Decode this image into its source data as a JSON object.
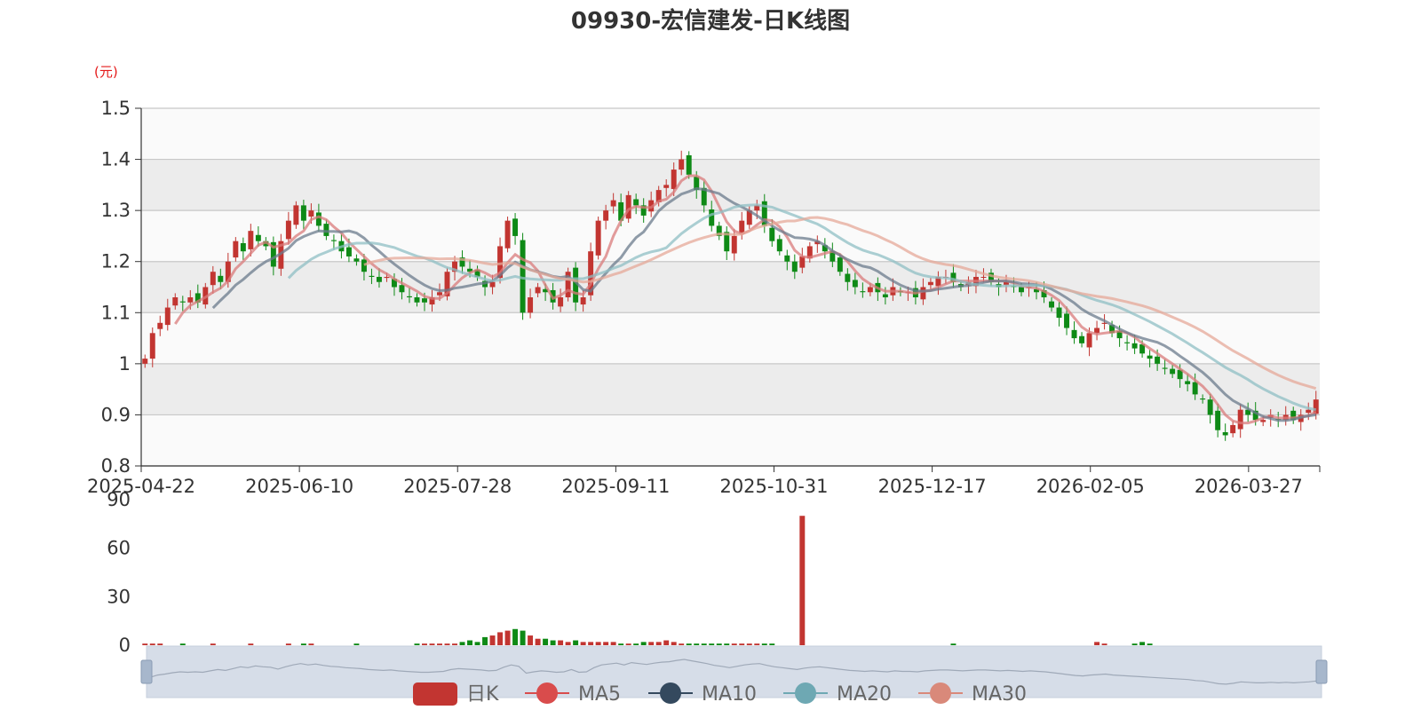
{
  "chart_data": {
    "type": "candlestick",
    "title": "09930-宏信建发-日K线图",
    "y_unit": "(元)",
    "price_axis": {
      "ylim": [
        0.8,
        1.5
      ],
      "ticks": [
        "1.5",
        "1.4",
        "1.3",
        "1.2",
        "1.1",
        "1",
        "0.9",
        "0.8"
      ]
    },
    "volume_axis": {
      "ylim": [
        0,
        90
      ],
      "ticks": [
        "90",
        "60",
        "30",
        "0"
      ]
    },
    "x_ticks": [
      "2025-04-22",
      "2025-06-10",
      "2025-07-28",
      "2025-09-11",
      "2025-10-31",
      "2025-12-17",
      "2026-02-05",
      "2026-03-27"
    ],
    "up_color": "#c23531",
    "down_color": "#0e8a16",
    "closes": [
      1.01,
      1.06,
      1.08,
      1.11,
      1.13,
      1.12,
      1.13,
      1.12,
      1.15,
      1.18,
      1.16,
      1.2,
      1.24,
      1.22,
      1.26,
      1.24,
      1.23,
      1.19,
      1.24,
      1.28,
      1.31,
      1.28,
      1.3,
      1.27,
      1.25,
      1.24,
      1.22,
      1.21,
      1.2,
      1.18,
      1.17,
      1.16,
      1.17,
      1.15,
      1.14,
      1.13,
      1.12,
      1.12,
      1.13,
      1.14,
      1.18,
      1.2,
      1.19,
      1.18,
      1.17,
      1.15,
      1.16,
      1.23,
      1.28,
      1.25,
      1.1,
      1.13,
      1.15,
      1.14,
      1.12,
      1.13,
      1.18,
      1.12,
      1.13,
      1.22,
      1.28,
      1.3,
      1.32,
      1.28,
      1.33,
      1.31,
      1.29,
      1.32,
      1.34,
      1.35,
      1.38,
      1.4,
      1.37,
      1.34,
      1.31,
      1.27,
      1.25,
      1.22,
      1.25,
      1.28,
      1.3,
      1.31,
      1.27,
      1.24,
      1.22,
      1.2,
      1.18,
      1.21,
      1.23,
      1.24,
      1.22,
      1.2,
      1.18,
      1.16,
      1.15,
      1.14,
      1.15,
      1.14,
      1.13,
      1.15,
      1.14,
      1.14,
      1.13,
      1.15,
      1.16,
      1.17,
      1.17,
      1.16,
      1.15,
      1.16,
      1.17,
      1.17,
      1.16,
      1.15,
      1.16,
      1.15,
      1.14,
      1.15,
      1.14,
      1.13,
      1.11,
      1.09,
      1.07,
      1.05,
      1.04,
      1.06,
      1.07,
      1.08,
      1.06,
      1.05,
      1.04,
      1.03,
      1.02,
      1.01,
      1.0,
      0.99,
      0.98,
      0.97,
      0.96,
      0.94,
      0.93,
      0.9,
      0.87,
      0.86,
      0.88,
      0.91,
      0.9,
      0.89,
      0.89,
      0.9,
      0.89,
      0.9,
      0.89,
      0.9,
      0.91,
      0.93
    ],
    "volumes": [
      1,
      1,
      1,
      0,
      0,
      1,
      0,
      0,
      0,
      1,
      0,
      0,
      0,
      0,
      1,
      0,
      0,
      0,
      0,
      1,
      0,
      1,
      1,
      0,
      0,
      0,
      0,
      0,
      1,
      0,
      0,
      0,
      0,
      0,
      0,
      0,
      1,
      1,
      1,
      1,
      1,
      1,
      2,
      3,
      2,
      5,
      6,
      8,
      9,
      10,
      9,
      6,
      4,
      4,
      3,
      3,
      2,
      3,
      2,
      2,
      2,
      2,
      2,
      1,
      1,
      1,
      2,
      2,
      2,
      3,
      2,
      1,
      1,
      1,
      1,
      1,
      1,
      1,
      1,
      1,
      1,
      1,
      1,
      1,
      0,
      0,
      0,
      80,
      0,
      0,
      0,
      0,
      0,
      0,
      0,
      0,
      0,
      0,
      0,
      0,
      0,
      0,
      0,
      0,
      0,
      0,
      0,
      1,
      0,
      0,
      0,
      0,
      0,
      0,
      0,
      0,
      0,
      0,
      0,
      0,
      0,
      0,
      0,
      0,
      0,
      0,
      2,
      1,
      0,
      0,
      0,
      1,
      2,
      1,
      0,
      0,
      0,
      0,
      0,
      0,
      0,
      0,
      0,
      0,
      0,
      0,
      0,
      0,
      0,
      0,
      0,
      0,
      0,
      0,
      0,
      0,
      0,
      0,
      0,
      0,
      0,
      0,
      0
    ],
    "series": [
      {
        "name": "MA5",
        "period": 5,
        "color": "#d97b7b"
      },
      {
        "name": "MA10",
        "period": 10,
        "color": "#6b7b8c"
      },
      {
        "name": "MA20",
        "period": 20,
        "color": "#8fbfc4"
      },
      {
        "name": "MA30",
        "period": 30,
        "color": "#e6a898"
      }
    ],
    "legend": [
      {
        "label": "日K",
        "color": "#c23531"
      },
      {
        "label": "MA5",
        "color": "#d94c4c"
      },
      {
        "label": "MA10",
        "color": "#34495e"
      },
      {
        "label": "MA20",
        "color": "#6ea8b3"
      },
      {
        "label": "MA30",
        "color": "#d9897a"
      }
    ],
    "grid": true,
    "legend_position": "bottom"
  }
}
